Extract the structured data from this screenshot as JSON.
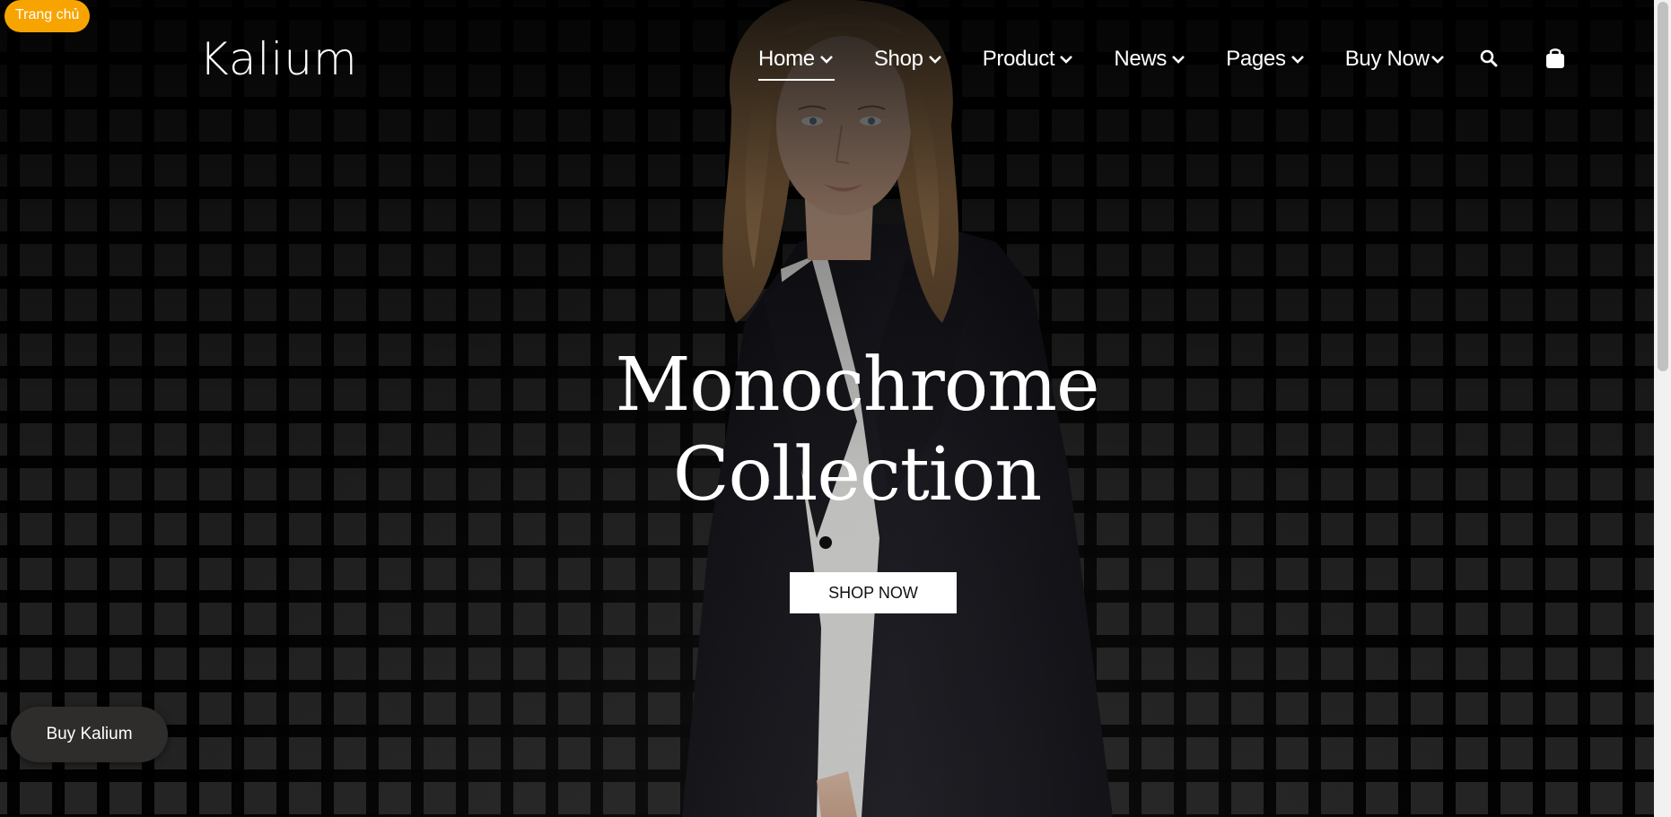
{
  "corner_badge": {
    "label": "Trang chủ"
  },
  "header": {
    "logo": "Kalium",
    "nav": [
      {
        "label": "Home",
        "active": true
      },
      {
        "label": "Shop"
      },
      {
        "label": "Product"
      },
      {
        "label": "News"
      },
      {
        "label": "Pages"
      },
      {
        "label": "Buy Now"
      }
    ],
    "icons": [
      "search-icon",
      "shopping-bag-icon"
    ]
  },
  "hero": {
    "title_line1": "Monochrome",
    "title_line2": "Collection",
    "cta_label": "SHOP NOW"
  },
  "floating_button": {
    "label": "Buy Kalium"
  },
  "colors": {
    "badge": "#f7a400",
    "background": "#0e0e0e",
    "text": "#ffffff",
    "floating_button": "#2e2d2c"
  }
}
